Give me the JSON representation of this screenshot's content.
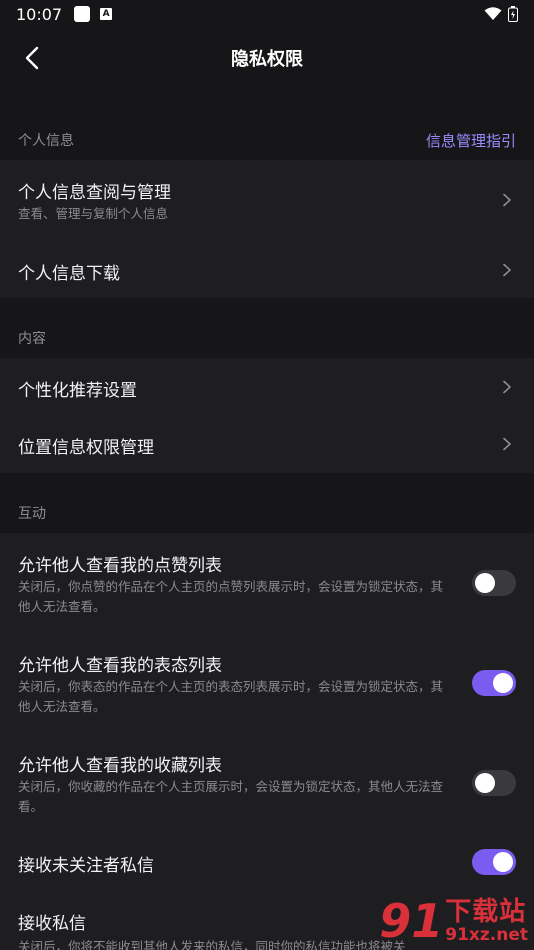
{
  "status_bar": {
    "time": "10:07",
    "notif_letter": "A"
  },
  "header": {
    "title": "隐私权限"
  },
  "personal_section": {
    "label": "个人信息",
    "guide_link": "信息管理指引",
    "items": [
      {
        "title": "个人信息查阅与管理",
        "subtitle": "查看、管理与复制个人信息"
      },
      {
        "title": "个人信息下载"
      }
    ]
  },
  "content_section": {
    "label": "内容",
    "items": [
      {
        "title": "个性化推荐设置"
      },
      {
        "title": "位置信息权限管理"
      }
    ]
  },
  "interaction_section": {
    "label": "互动",
    "items": [
      {
        "title": "允许他人查看我的点赞列表",
        "desc": "关闭后，你点赞的作品在个人主页的点赞列表展示时，会设置为锁定状态，其他人无法查看。",
        "enabled": false
      },
      {
        "title": "允许他人查看我的表态列表",
        "desc": "关闭后，你表态的作品在个人主页的表态列表展示时，会设置为锁定状态，其他人无法查看。",
        "enabled": true
      },
      {
        "title": "允许他人查看我的收藏列表",
        "desc": "关闭后，你收藏的作品在个人主页展示时，会设置为锁定状态，其他人无法查看。",
        "enabled": false
      },
      {
        "title": "接收未关注者私信",
        "enabled": true
      },
      {
        "title": "接收私信",
        "desc": "关闭后，你将不能收到其他人发来的私信，同时你的私信功能也将被关"
      }
    ]
  },
  "watermark": {
    "mark": "91",
    "top": "下载站",
    "bottom": "91xz.net"
  },
  "colors": {
    "accent": "#7a5cf0",
    "link": "#9a8cff",
    "background": "#161618",
    "card": "#1e1e21"
  }
}
